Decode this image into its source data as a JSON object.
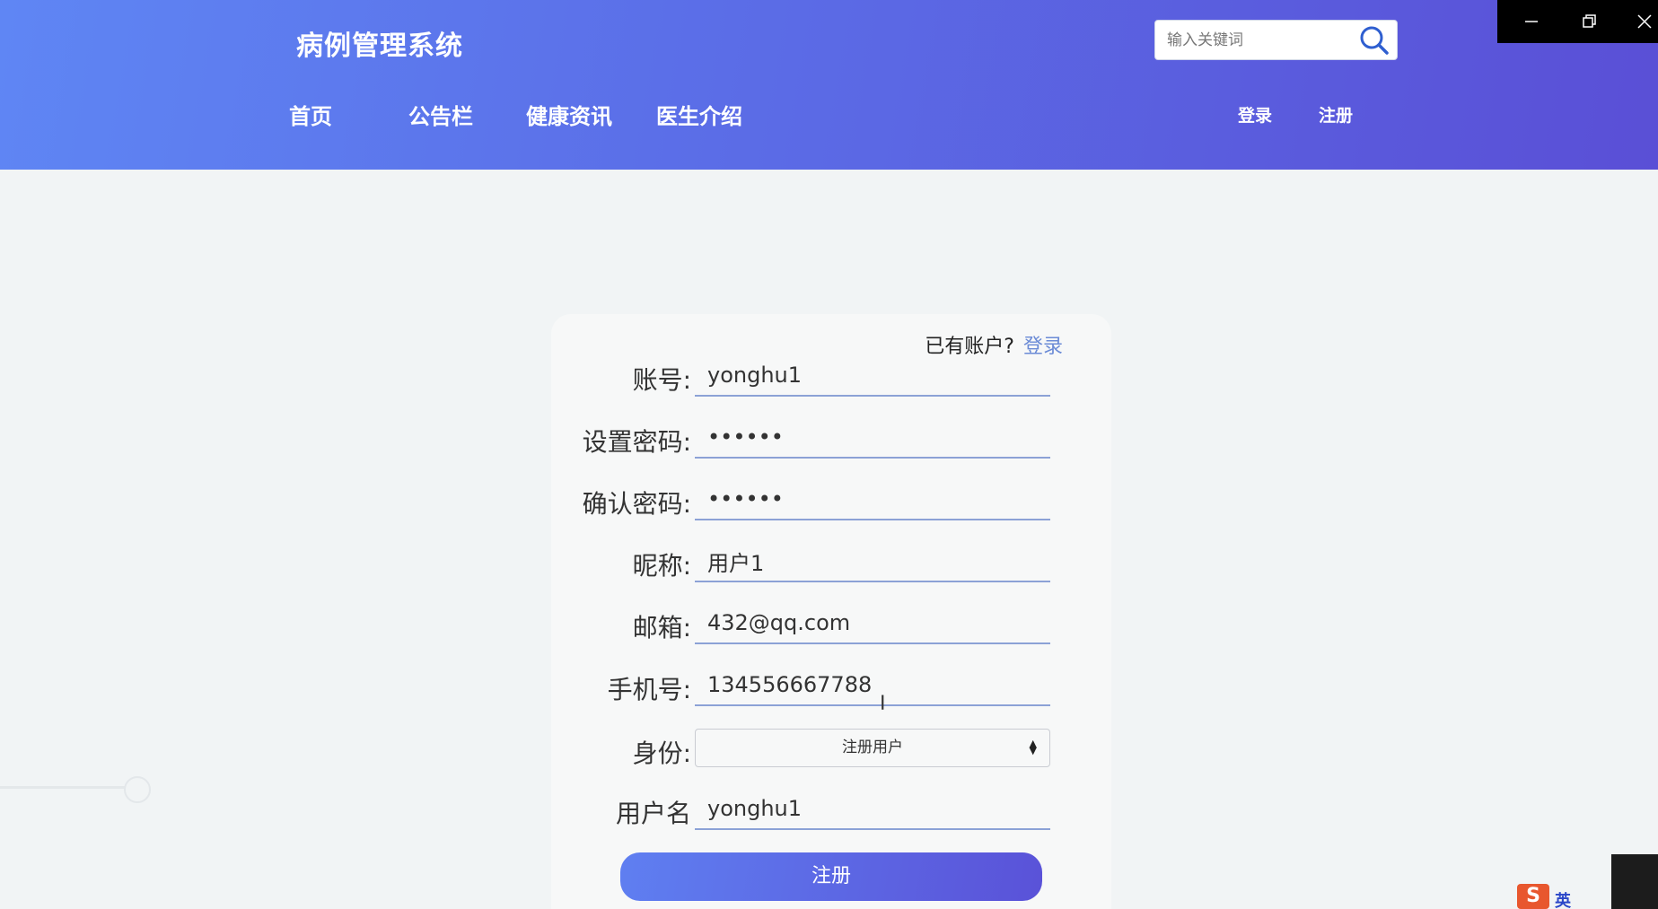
{
  "header": {
    "brand": "病例管理系统",
    "nav": [
      "首页",
      "公告栏",
      "健康资讯",
      "医生介绍"
    ],
    "login": "登录",
    "register": "注册",
    "search_placeholder": "输入关键词"
  },
  "form": {
    "has_account": "已有账户?",
    "login_link": "登录",
    "fields": [
      {
        "label": "账号:",
        "value": "yonghu1"
      },
      {
        "label": "设置密码:",
        "value": "••••••"
      },
      {
        "label": "确认密码:",
        "value": "••••••"
      },
      {
        "label": "昵称:",
        "value": "用户1"
      },
      {
        "label": "邮箱:",
        "value": "432@qq.com"
      },
      {
        "label": "手机号:",
        "value": "134556667788"
      }
    ],
    "role_label": "身份:",
    "role_selected": "注册用户",
    "username_label": "用户名",
    "username_value": "yonghu1",
    "submit": "注册"
  },
  "tray": {
    "ime_icon": "S",
    "ime_text": "英"
  },
  "colors": {
    "header_start": "#5f86f4",
    "header_end": "#5a4fd6",
    "link": "#6b8bd6",
    "input_underline": "#8ca2d6"
  }
}
